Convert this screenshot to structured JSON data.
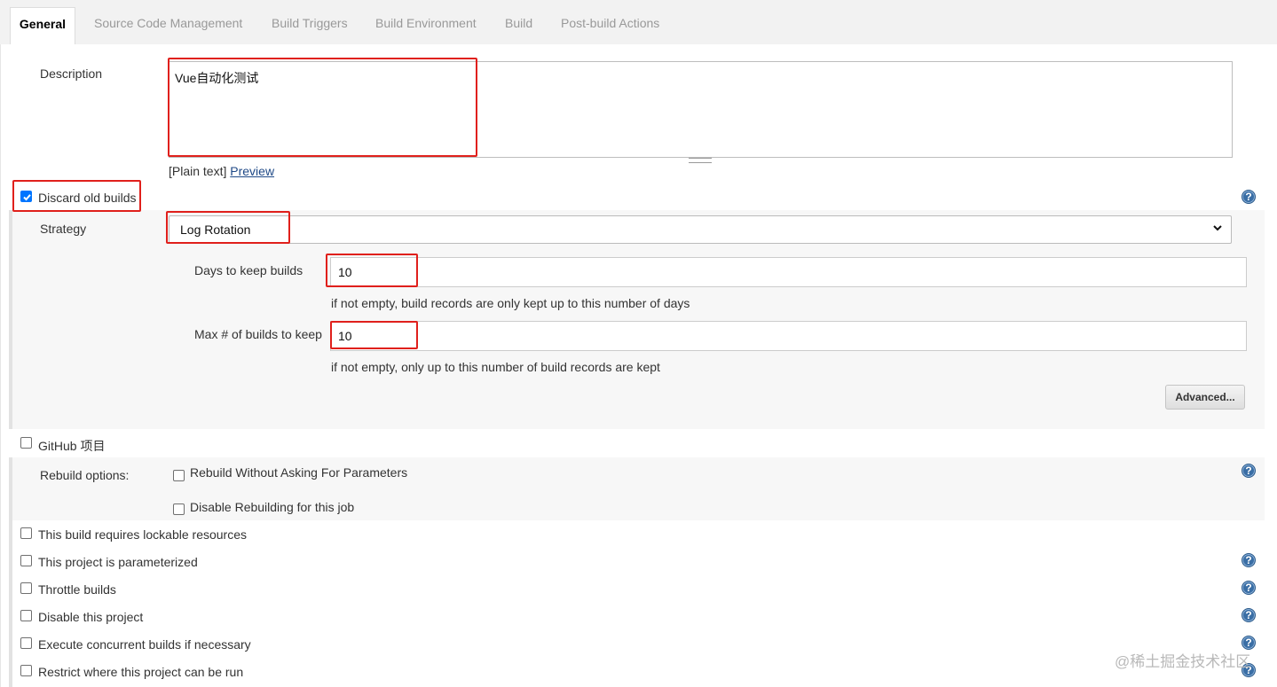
{
  "tabs": [
    {
      "label": "General",
      "active": true
    },
    {
      "label": "Source Code Management"
    },
    {
      "label": "Build Triggers"
    },
    {
      "label": "Build Environment"
    },
    {
      "label": "Build"
    },
    {
      "label": "Post-build Actions"
    }
  ],
  "description": {
    "label": "Description",
    "value": "Vue自动化测试",
    "format_prefix": "[Plain text]",
    "preview_link": "Preview"
  },
  "discard_old_builds": {
    "label": "Discard old builds",
    "checked": true,
    "strategy_label": "Strategy",
    "strategy_value": "Log Rotation",
    "days_label": "Days to keep builds",
    "days_value": "10",
    "days_help": "if not empty, build records are only kept up to this number of days",
    "max_label": "Max # of builds to keep",
    "max_value": "10",
    "max_help": "if not empty, only up to this number of build records are kept",
    "advanced_button": "Advanced..."
  },
  "github_project": {
    "label": "GitHub 项目",
    "checked": false
  },
  "rebuild": {
    "label": "Rebuild options:",
    "option1": "Rebuild Without Asking For Parameters",
    "option2": "Disable Rebuilding for this job"
  },
  "options": [
    {
      "label": "This build requires lockable resources",
      "checked": false
    },
    {
      "label": "This project is parameterized",
      "checked": false
    },
    {
      "label": "Throttle builds",
      "checked": false
    },
    {
      "label": "Disable this project",
      "checked": false
    },
    {
      "label": "Execute concurrent builds if necessary",
      "checked": false
    },
    {
      "label": "Restrict where this project can be run",
      "checked": false
    }
  ],
  "help_icon_glyph": "?",
  "watermark": "@稀土掘金技术社区",
  "colors": {
    "highlight_box": "#e0201c",
    "link": "#204a87",
    "help_icon": "#3a6ea5",
    "checkbox_checked": "#0075ff"
  }
}
